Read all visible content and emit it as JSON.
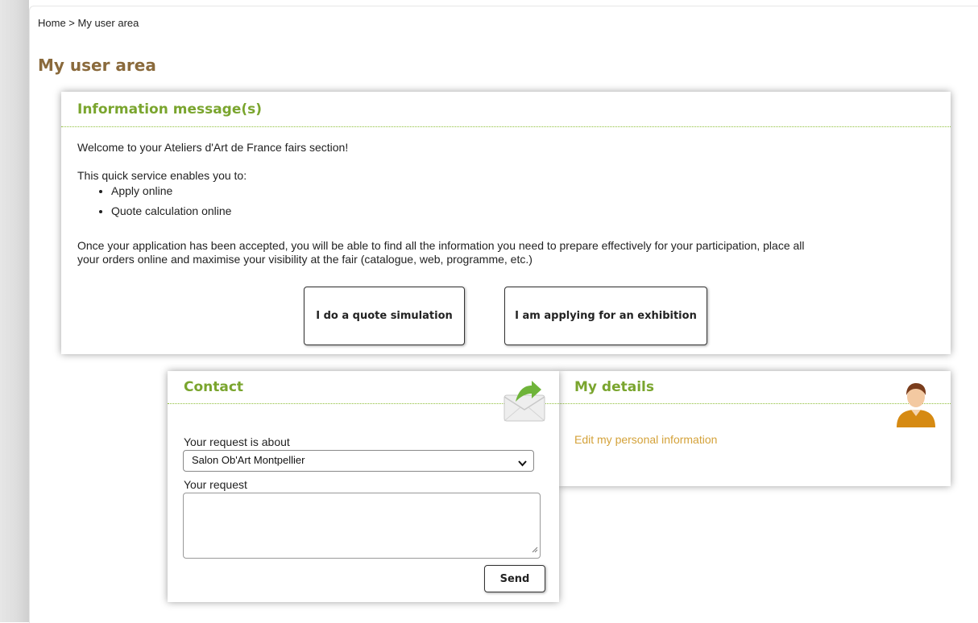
{
  "breadcrumb": {
    "home": "Home",
    "separator": " > ",
    "current": "My user area"
  },
  "page": {
    "title": "My user area"
  },
  "info_panel": {
    "title": "Information message(s)",
    "welcome": "Welcome to your Ateliers d'Art de France fairs section!",
    "intro": "This quick service enables you to:",
    "items": [
      "Apply online",
      "Quote calculation online"
    ],
    "paragraph_line1": "Once your application has been accepted, you will be able to find all the information you need to prepare effectively for your participation, place all",
    "paragraph_line2": "your orders online and maximise your visibility at the fair (catalogue, web, programme, etc.)",
    "quote_button": "I do a quote simulation",
    "apply_button": "I am applying for an exhibition"
  },
  "contact_panel": {
    "title": "Contact",
    "icon": "mail-send-icon",
    "request_about_label": "Your request is about",
    "request_about_value": "Salon Ob'Art Montpellier",
    "request_label": "Your request",
    "request_value": "",
    "send_button": "Send"
  },
  "details_panel": {
    "title": "My details",
    "icon": "user-avatar-icon",
    "edit_link": "Edit my personal information"
  },
  "colors": {
    "title_brown": "#8a6a3c",
    "panel_green": "#7aa52e",
    "link_gold": "#d4a23a"
  }
}
